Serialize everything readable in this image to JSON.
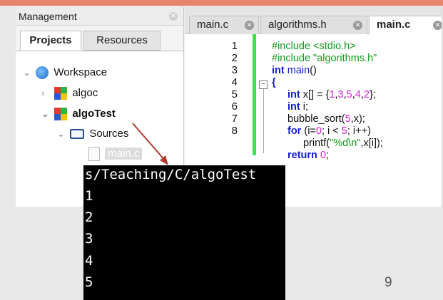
{
  "accent_color": "#e8836e",
  "management": {
    "title": "Management",
    "tabs": [
      {
        "label": "Projects",
        "active": true
      },
      {
        "label": "Resources",
        "active": false
      }
    ],
    "tree": [
      {
        "label": "Workspace",
        "icon": "globe-icon"
      },
      {
        "label": "algoc",
        "icon": "project-icon"
      },
      {
        "label": "algoTest",
        "icon": "project-icon"
      },
      {
        "label": "Sources",
        "icon": "folder-open-icon"
      },
      {
        "label": "main.c",
        "icon": "file-icon"
      }
    ]
  },
  "editor": {
    "tabs": [
      {
        "label": "main.c",
        "active": false
      },
      {
        "label": "algorithms.h",
        "active": false
      },
      {
        "label": "main.c",
        "active": true
      }
    ],
    "line_numbers": [
      "1",
      "2",
      "3",
      "4",
      "5",
      "6",
      "7",
      "8"
    ]
  },
  "terminal": {
    "lines": [
      "s/Teaching/C/algoTest",
      "1",
      "2",
      "3",
      "4",
      "5"
    ]
  },
  "page_number": "9"
}
